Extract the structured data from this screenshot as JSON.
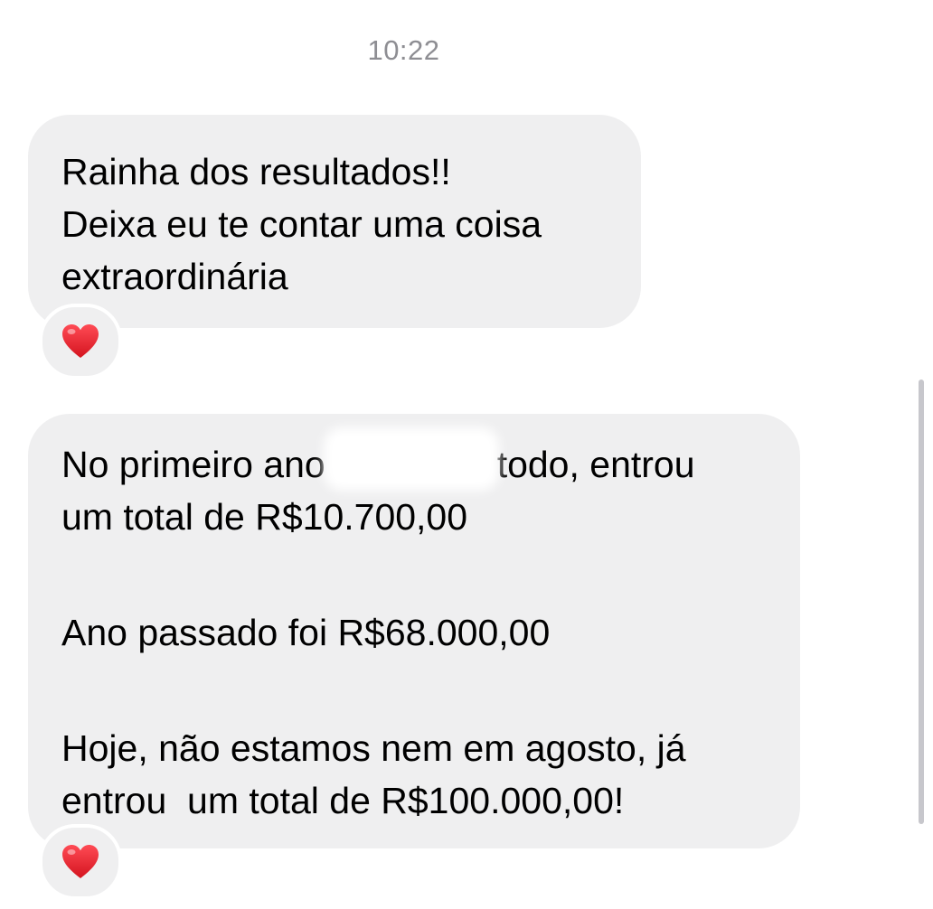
{
  "header": {
    "timestamp": "10:22"
  },
  "messages": [
    {
      "lines": [
        "Rainha dos resultados!!",
        "Deixa eu te contar uma coisa",
        "extraordinária"
      ],
      "reaction": "heart-icon"
    },
    {
      "paragraph1": {
        "line1_start": "No primeiro ano",
        "line1_end": "todo, entrou",
        "line2": "um total de R$10.700,00"
      },
      "paragraph2": "Ano passado foi R$68.000,00",
      "paragraph3": {
        "line1": "Hoje, não estamos nem em agosto, já",
        "line2": "entrou  um total de R$100.000,00!"
      },
      "reaction": "heart-icon"
    }
  ],
  "colors": {
    "bubble": "#efeff0",
    "timestamp": "#8e8e93",
    "heart": "#e8212e"
  }
}
